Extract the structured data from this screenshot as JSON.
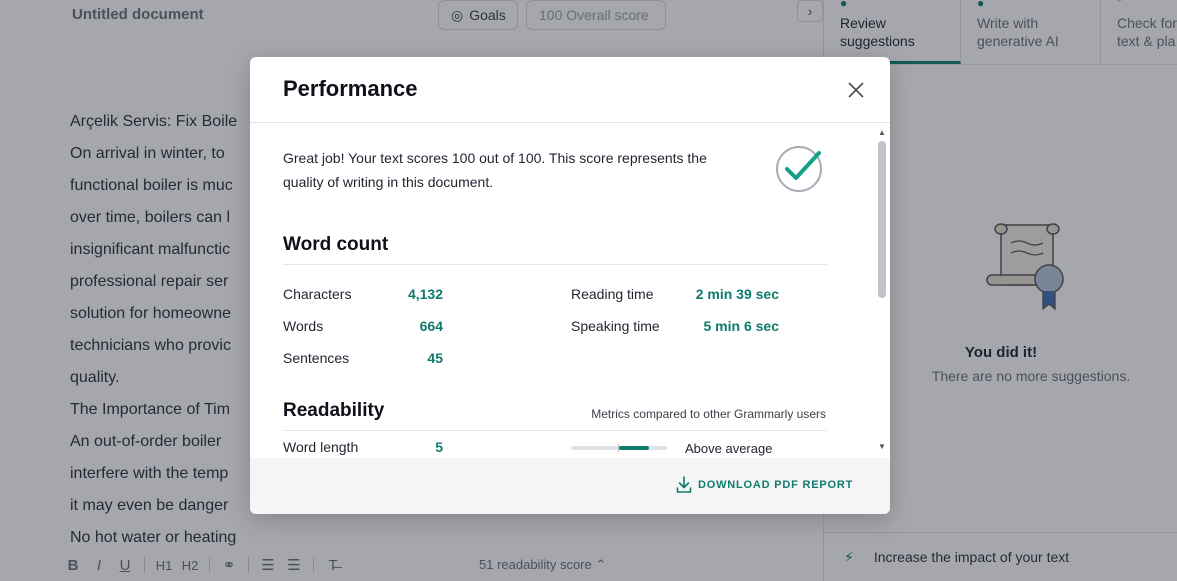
{
  "editor": {
    "doc_title": "Untitled document",
    "goals_label": "Goals",
    "overall_score": "100 Overall score",
    "collapse_icon": "chevron-right-icon",
    "lines": [
      "Arçelik Servis: Fix Boile",
      "On arrival in winter, to",
      "functional boiler is muc",
      "over time, boilers can l",
      "insignificant malfunctic",
      "professional repair ser",
      "solution for homeowne",
      "technicians who provic",
      "quality.",
      "The Importance of Tim",
      "An out-of-order boiler",
      "interfere with the temp",
      "it may even be danger",
      "No hot water or heating"
    ],
    "toolbar": [
      "B",
      "I",
      "U",
      "H1",
      "H2",
      "link",
      "ordered-list",
      "bullet-list",
      "clear-format"
    ],
    "readability_score": "51 readability score"
  },
  "sidebar": {
    "tabs": [
      "Review suggestions",
      "Write with generative AI",
      "Check for text & pla"
    ],
    "done_title": "You did it!",
    "done_subtitle": "There are no more suggestions.",
    "impact_text": "Increase the impact of your text"
  },
  "modal": {
    "title": "Performance",
    "intro": "Great job! Your text scores 100 out of 100. This score represents the quality of writing in this document.",
    "word_count": {
      "title": "Word count",
      "characters_label": "Characters",
      "characters_value": "4,132",
      "words_label": "Words",
      "words_value": "664",
      "sentences_label": "Sentences",
      "sentences_value": "45",
      "reading_label": "Reading time",
      "reading_value": "2 min 39 sec",
      "speaking_label": "Speaking time",
      "speaking_value": "5 min 6 sec"
    },
    "readability": {
      "title": "Readability",
      "compare_note": "Metrics compared to other Grammarly users",
      "word_length_label": "Word length",
      "word_length_value": "5",
      "word_length_level": 0.6,
      "word_length_verdict": "Above average"
    },
    "download_label": "DOWNLOAD PDF REPORT"
  },
  "colors": {
    "accent": "#0f7b6c",
    "overlay": "rgba(30,36,50,0.40)"
  }
}
